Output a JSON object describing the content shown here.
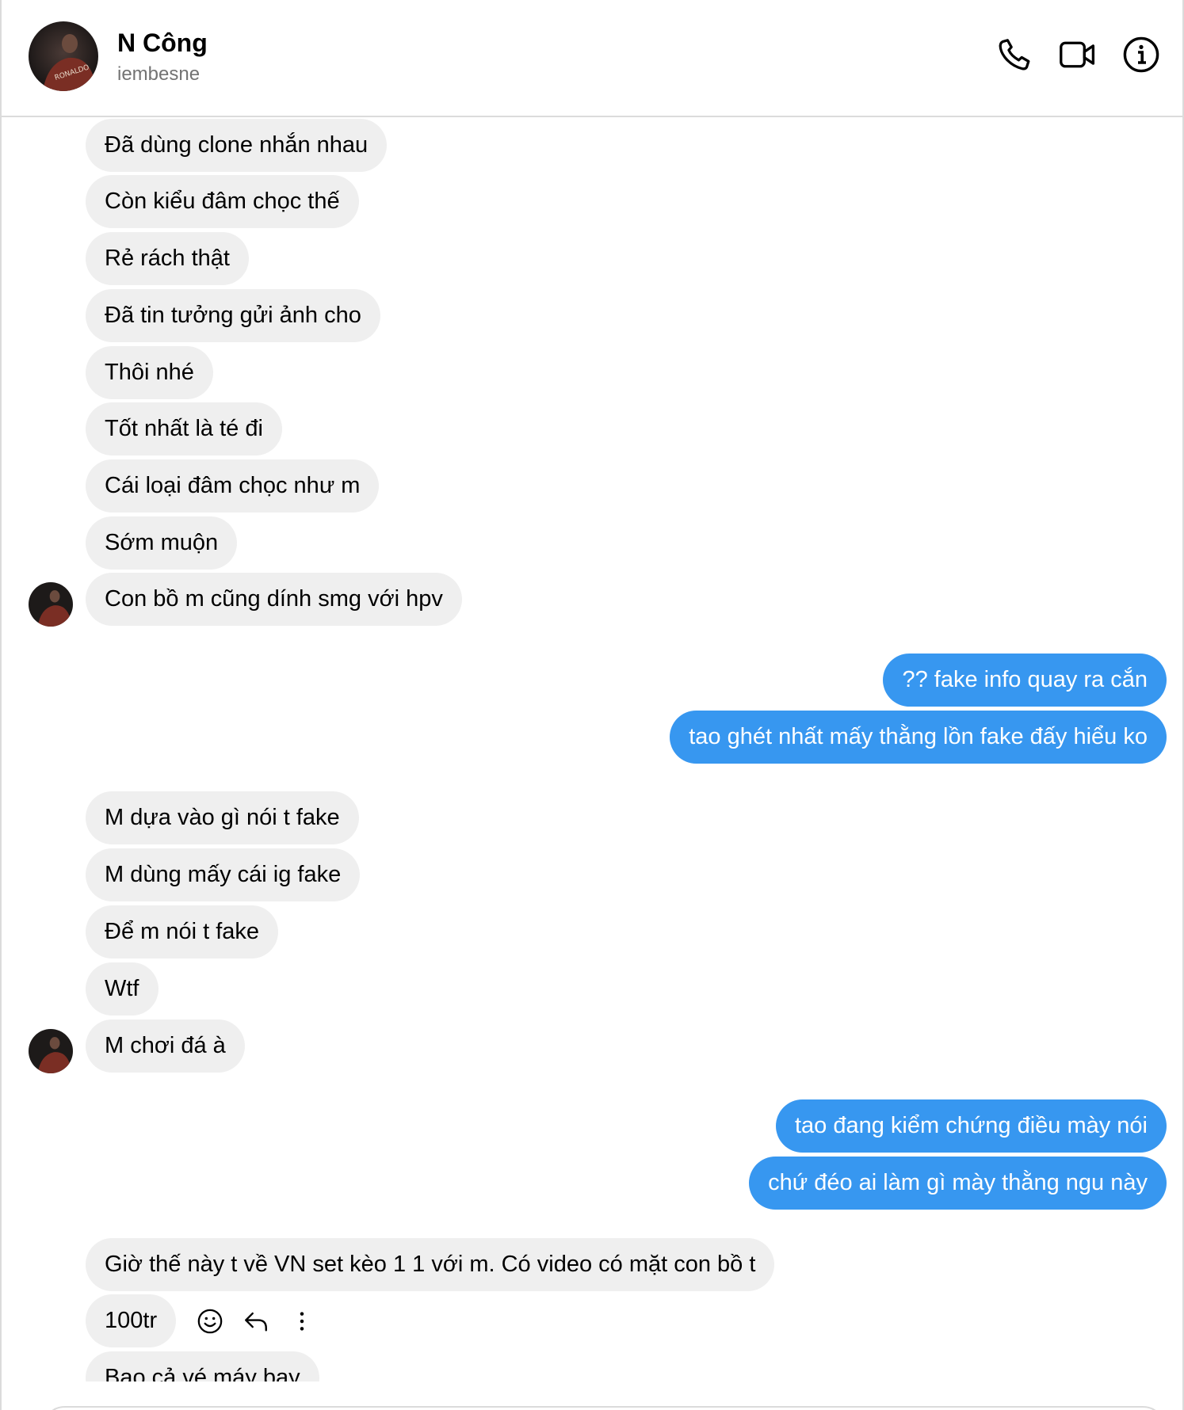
{
  "header": {
    "name": "N Công",
    "username": "iembesne",
    "avatar_jersey_text": "RONALDO"
  },
  "icons": {
    "call": "phone-icon",
    "video": "video-camera-icon",
    "info": "info-icon",
    "react": "smiley-icon",
    "reply": "reply-arrow-icon",
    "more": "more-vertical-icon"
  },
  "colors": {
    "outgoing_bubble": "#3797f0",
    "incoming_bubble": "#efefef",
    "secondary_text": "#737373"
  },
  "messages": [
    {
      "dir": "in",
      "text": "Đã dùng clone nhắn nhau"
    },
    {
      "dir": "in",
      "text": "Còn kiểu đâm chọc thế"
    },
    {
      "dir": "in",
      "text": "Rẻ rách thật"
    },
    {
      "dir": "in",
      "text": "Đã tin tưởng gửi ảnh cho"
    },
    {
      "dir": "in",
      "text": "Thôi nhé"
    },
    {
      "dir": "in",
      "text": "Tốt nhất là té đi"
    },
    {
      "dir": "in",
      "text": "Cái loại đâm chọc như m"
    },
    {
      "dir": "in",
      "text": "Sớm muộn"
    },
    {
      "dir": "in",
      "text": "Con bồ m cũng dính smg với hpv"
    },
    {
      "dir": "out",
      "text": "?? fake info quay ra cắn"
    },
    {
      "dir": "out",
      "text": "tao ghét nhất mấy thằng lồn fake đấy hiểu ko"
    },
    {
      "dir": "in",
      "text": "M dựa vào gì nói t fake"
    },
    {
      "dir": "in",
      "text": "M dùng mấy cái ig fake"
    },
    {
      "dir": "in",
      "text": "Để m nói t fake"
    },
    {
      "dir": "in",
      "text": "Wtf"
    },
    {
      "dir": "in",
      "text": "M chơi đá à"
    },
    {
      "dir": "out",
      "text": "tao đang kiểm chứng điều mày nói"
    },
    {
      "dir": "out",
      "text": "chứ đéo ai làm gì mày thằng ngu này"
    },
    {
      "dir": "in",
      "text": "Giờ thế này t về VN set kèo 1 1 với m. Có video có mặt con bồ t"
    },
    {
      "dir": "in",
      "text": "100tr"
    },
    {
      "dir": "in",
      "text": "Bao cả vé máy bay"
    }
  ]
}
